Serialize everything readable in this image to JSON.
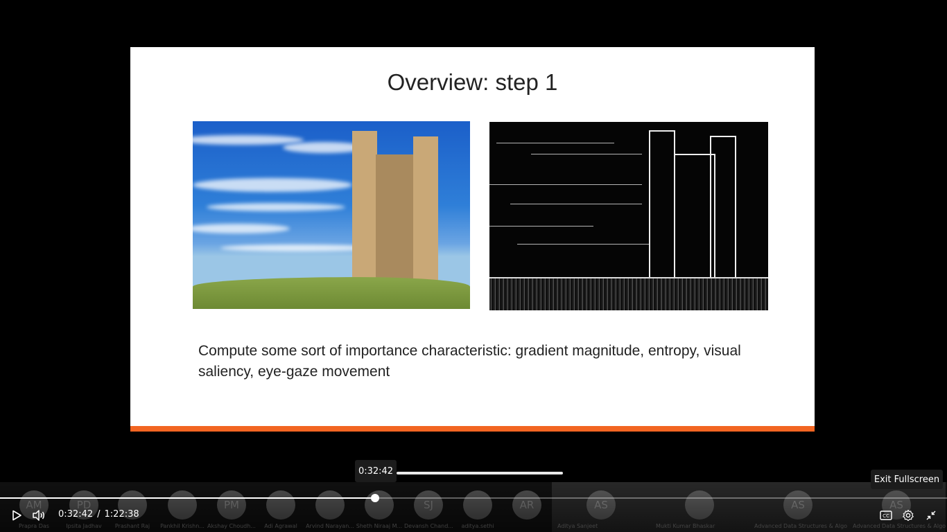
{
  "slide": {
    "title": "Overview: step 1",
    "body": "Compute some sort of importance characteristic: gradient magnitude, entropy, visual saliency, eye-gaze movement",
    "accent_color": "#f26522"
  },
  "player": {
    "hover_time": "0:32:42",
    "current_time": "0:32:42",
    "separator": "/",
    "duration": "1:22:38",
    "progress_fraction": 0.396,
    "tooltip": "Exit Fullscreen",
    "icons": {
      "play": "play-icon",
      "volume": "volume-icon",
      "captions": "captions-icon",
      "settings": "gear-icon",
      "exit_fullscreen": "exit-fullscreen-icon"
    }
  },
  "participants": [
    {
      "initials": "AM",
      "name": "Prapra Das"
    },
    {
      "initials": "PD",
      "name": "Ipsita Jadhav"
    },
    {
      "initials": "",
      "name": "Prashant Raj"
    },
    {
      "initials": "",
      "name": "Pankhil Krishn..."
    },
    {
      "initials": "PM",
      "name": "Akshay Choudh..."
    },
    {
      "initials": "",
      "name": "Adi Agrawal"
    },
    {
      "initials": "",
      "name": "Arvind Narayan..."
    },
    {
      "initials": "",
      "name": "Sheth Niraaj M..."
    },
    {
      "initials": "SJ",
      "name": "Devansh Chand..."
    },
    {
      "initials": "",
      "name": "aditya.sethi"
    },
    {
      "initials": "AR",
      "name": ""
    },
    {
      "initials": "AS",
      "name": "Aditya Sanjeet"
    },
    {
      "initials": "",
      "name": "Mukti Kumar Bhaskar"
    },
    {
      "initials": "AS",
      "name": "Advanced Data Structures & Algorit..."
    },
    {
      "initials": "AS",
      "name": "Advanced Data Structures & Algori..."
    }
  ]
}
